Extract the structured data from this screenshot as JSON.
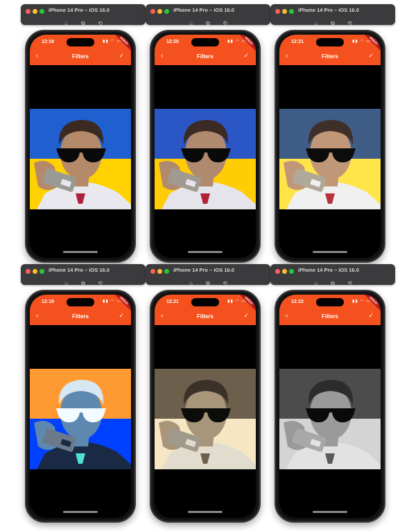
{
  "simulators": [
    {
      "window_title": "iPhone 14 Pro – iOS 16.0",
      "status_time": "12:18",
      "screen_title": "Filters",
      "filter_colors": {
        "top": "#1f5fd0",
        "bottom": "#ffd100",
        "skin": "#b48a6a",
        "hair": "#3a2a22",
        "shirt": "#e8e8ee",
        "glasses": "#0a0a0a",
        "phone": "#9a9a94",
        "tie": "#b0203a",
        "face_filter": "none"
      }
    },
    {
      "window_title": "iPhone 14 Pro – iOS 16.0",
      "status_time": "12:20",
      "screen_title": "Filters",
      "filter_colors": {
        "top": "#2b57c6",
        "bottom": "#ffcc05",
        "skin": "#b08a6e",
        "hair": "#3b2b24",
        "shirt": "#e4e4ea",
        "glasses": "#0a0a0a",
        "phone": "#a09a90",
        "tie": "#b02236",
        "face_filter": "none"
      }
    },
    {
      "window_title": "iPhone 14 Pro – iOS 16.0",
      "status_time": "12:21",
      "screen_title": "Filters",
      "filter_colors": {
        "top": "#3e5c85",
        "bottom": "#ffe44a",
        "skin": "#c09878",
        "hair": "#3e3028",
        "shirt": "#f0f0f0",
        "glasses": "#0c0c0c",
        "phone": "#b0a898",
        "tie": "#b8303c",
        "face_filter": "none"
      }
    },
    {
      "window_title": "iPhone 14 Pro – iOS 16.0",
      "status_time": "12:19",
      "screen_title": "Filters",
      "filter_colors": {
        "top": "#ff9a33",
        "bottom": "#0040ff",
        "skin": "#5d88b0",
        "hair": "#d8e8f2",
        "shirt": "#1a2a44",
        "glasses": "#f2fbff",
        "phone": "#6a7a8a",
        "tie": "#50e0d0",
        "face_filter": "invert"
      }
    },
    {
      "window_title": "iPhone 14 Pro – iOS 16.0",
      "status_time": "12:21",
      "screen_title": "Filters",
      "filter_colors": {
        "top": "#6c604c",
        "bottom": "#f6e6c4",
        "skin": "#a8957a",
        "hair": "#3a3228",
        "shirt": "#e2dccf",
        "glasses": "#0c0c0a",
        "phone": "#a09a8c",
        "tie": "#6e5e4c",
        "face_filter": "sepia"
      }
    },
    {
      "window_title": "iPhone 14 Pro – iOS 16.0",
      "status_time": "12:22",
      "screen_title": "Filters",
      "filter_colors": {
        "top": "#4c4c4c",
        "bottom": "#d4d4d4",
        "skin": "#9a9a9a",
        "hair": "#2c2c2c",
        "shirt": "#e2e2e2",
        "glasses": "#0a0a0a",
        "phone": "#a8a8a8",
        "tie": "#5a5a5a",
        "face_filter": "grayscale"
      }
    }
  ],
  "icons": {
    "toolbar": [
      "home-icon",
      "screenshot-icon",
      "rotate-icon"
    ],
    "back": "chevron-left-icon",
    "confirm": "check-icon"
  },
  "debug_banner": "DEBUG",
  "accent": "#f4511e"
}
